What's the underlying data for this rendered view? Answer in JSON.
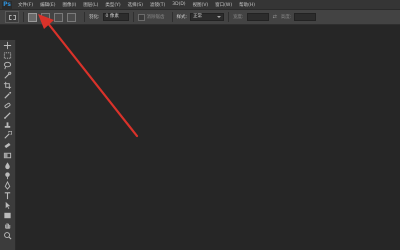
{
  "app": {
    "logo_text": "Ps"
  },
  "menu": [
    "文件(F)",
    "编辑(E)",
    "图像(I)",
    "图层(L)",
    "类型(Y)",
    "选择(S)",
    "滤镜(T)",
    "3D(D)",
    "视图(V)",
    "窗口(W)",
    "帮助(H)"
  ],
  "options": {
    "feather_label": "羽化:",
    "feather_value": "0 像素",
    "antialias_label": "消除锯齿",
    "style_label": "样式:",
    "style_value": "正常",
    "width_label": "宽度:",
    "height_label": "高度:"
  },
  "tools": [
    "move",
    "marquee",
    "lasso",
    "quick-select",
    "crop",
    "eyedropper",
    "healing",
    "brush",
    "clone-stamp",
    "history-brush",
    "eraser",
    "gradient",
    "blur",
    "dodge",
    "pen",
    "type",
    "path-select",
    "shape",
    "hand",
    "zoom"
  ],
  "annotation": {
    "color": "#d9322a"
  }
}
